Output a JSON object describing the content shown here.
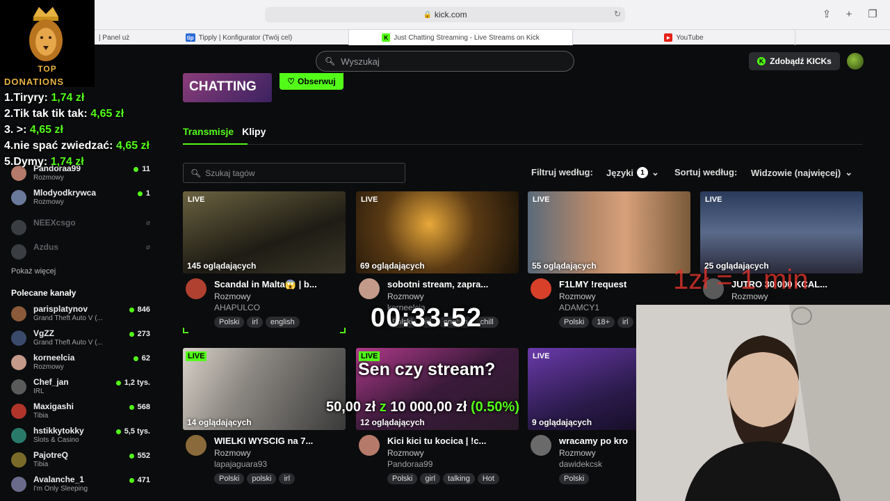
{
  "browser": {
    "url": "kick.com",
    "tabs": [
      {
        "label": "| Panel użytkownika",
        "fav_color": "#3a3a3a",
        "fav_text": ""
      },
      {
        "label": "Tipply | Konfigurator (Twój cel)",
        "fav_color": "#2a6bd6",
        "fav_text": "tip"
      },
      {
        "label": "Just Chatting Streaming - Live Streams on Kick",
        "fav_color": "#53fc18",
        "fav_text": "K"
      },
      {
        "label": "YouTube",
        "fav_color": "#e62117",
        "fav_text": "▶"
      }
    ]
  },
  "topbar": {
    "search_placeholder": "Wyszukaj",
    "kicks_label": "Zdobądź KICKs"
  },
  "donations": {
    "top_label": "TOP",
    "label": "DONATIONS",
    "items": [
      {
        "rank": "1.",
        "name": "Tiryry:",
        "amount": "1,74 zł"
      },
      {
        "rank": "2.",
        "name": "Tik tak tik tak:",
        "amount": "4,65 zł"
      },
      {
        "rank": "3.",
        "name": ">:",
        "amount": "4,65 zł"
      },
      {
        "rank": "4.",
        "name": "nie spać zwiedzać:",
        "amount": "4,65 zł"
      },
      {
        "rank": "5.",
        "name": "Dymy:",
        "amount": "1,74 zł"
      }
    ]
  },
  "sidebar": {
    "followed": [
      {
        "name": "Pandoraa99",
        "category": "Rozmowy",
        "viewers": "11",
        "online": true,
        "avatar": "#b57a6a"
      },
      {
        "name": "Mlodyodkrywca",
        "category": "Rozmowy",
        "viewers": "1",
        "online": true,
        "avatar": "#6b7a9a"
      },
      {
        "name": "NEEXcsgo",
        "category": "",
        "viewers": "",
        "online": false,
        "avatar": "#4a4d52"
      },
      {
        "name": "Azdus",
        "category": "",
        "viewers": "",
        "online": false,
        "avatar": "#4a4d52"
      }
    ],
    "show_more": "Pokaż więcej",
    "recommended_heading": "Polecane kanały",
    "recommended": [
      {
        "name": "parisplatynov",
        "category": "Grand Theft Auto V (...",
        "viewers": "846",
        "avatar": "#8a5a3a"
      },
      {
        "name": "VgZZ",
        "category": "Grand Theft Auto V (...",
        "viewers": "273",
        "avatar": "#3a4a6a"
      },
      {
        "name": "korneelcia",
        "category": "Rozmowy",
        "viewers": "62",
        "avatar": "#c49a8a"
      },
      {
        "name": "Chef_jan",
        "category": "IRL",
        "viewers": "1,2 tys.",
        "avatar": "#5a5a5a"
      },
      {
        "name": "Maxigashi",
        "category": "Tibia",
        "viewers": "568",
        "avatar": "#b0342a"
      },
      {
        "name": "hstikkytokky",
        "category": "Slots & Casino",
        "viewers": "5,5 tys.",
        "avatar": "#2a7a6a"
      },
      {
        "name": "PajotreQ",
        "category": "Tibia",
        "viewers": "552",
        "avatar": "#7a6a2a"
      },
      {
        "name": "Avalanche_1",
        "category": "I'm Only Sleeping",
        "viewers": "471",
        "avatar": "#6a6a8a"
      }
    ]
  },
  "main": {
    "category_image_text": "CHATTING",
    "follow_label": "Obserwuj",
    "tabs": [
      "Transmisje",
      "Klipy"
    ],
    "tag_search_placeholder": "Szukaj tagów",
    "filter_label": "Filtruj według:",
    "languages_label": "Języki",
    "languages_count": "1",
    "sort_label": "Sortuj według:",
    "sort_value": "Widzowie (najwięcej)",
    "live_badge": "LIVE",
    "streams": [
      {
        "title": "Scandal in Malta😱 | b...",
        "category": "Rozmowy",
        "user": "AHAPULCO",
        "viewers": "145 oglądających",
        "tags": [
          "Polski",
          "irl",
          "english"
        ],
        "thumb": "#3a3628",
        "avatar": "#b04030"
      },
      {
        "title": "sobotni stream, zapra...",
        "category": "Rozmowy",
        "user": "korneelcia",
        "viewers": "69 oglądających",
        "tags": [
          "Polski",
          "irl",
          "english",
          "chill"
        ],
        "thumb": "#4a3a1c",
        "avatar": "#c49a8a"
      },
      {
        "title": "F1LMY !request",
        "category": "Rozmowy",
        "user": "ADAMCY1",
        "viewers": "55 oglądających",
        "tags": [
          "Polski",
          "18+",
          "irl"
        ],
        "thumb": "#7a5a4a",
        "avatar": "#d8402a"
      },
      {
        "title": "JUTRO 30 000 KCAL...",
        "category": "Rozmowy",
        "user": "",
        "viewers": "25 oglądających",
        "tags": [],
        "thumb": "#3a4a6a",
        "avatar": "#5a5a5a"
      },
      {
        "title": "WIELKI WYSCIG na 7...",
        "category": "Rozmowy",
        "user": "lapajaguara93",
        "viewers": "14 oglądających",
        "tags": [
          "Polski",
          "polski",
          "irl"
        ],
        "thumb": "#6a6a6a",
        "avatar": "#8a6a3a"
      },
      {
        "title": "Kici kici tu kocica | !c...",
        "category": "Rozmowy",
        "user": "Pandoraa99",
        "viewers": "12 oglądających",
        "tags": [
          "Polski",
          "girl",
          "talking",
          "Hot"
        ],
        "thumb": "#5a2a5a",
        "avatar": "#b57a6a"
      },
      {
        "title": "wracamy po kro",
        "category": "Rozmowy",
        "user": "dawidekcsk",
        "viewers": "9 oglądających",
        "tags": [
          "Polski"
        ],
        "thumb": "#2a1a4a",
        "avatar": "#6a6a6a"
      }
    ]
  },
  "overlay": {
    "timer": "00:33:52",
    "rate": "1zł = 1 min",
    "goal_title": "Sen czy stream?",
    "goal_current": "50,00 zł",
    "goal_sep": "z",
    "goal_target": "10 000,00 zł",
    "goal_percent": "(0.50%)"
  }
}
